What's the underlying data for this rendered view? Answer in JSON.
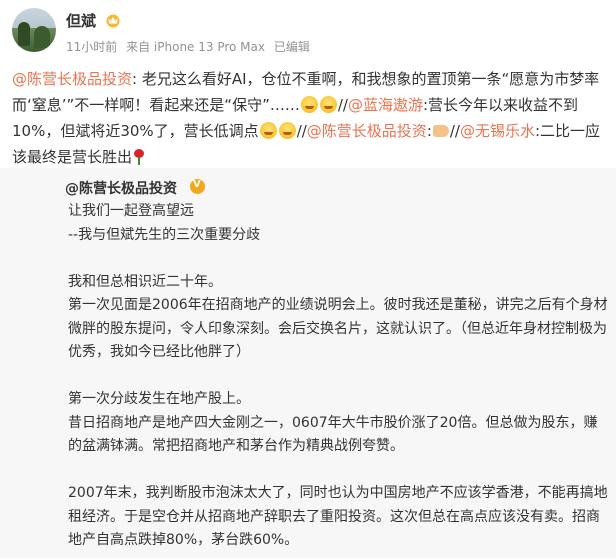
{
  "user": {
    "name": "但斌",
    "time": "11小时前",
    "source": "来自 iPhone 13 Pro Max",
    "edited": "已编辑"
  },
  "post": {
    "m1": "@陈营长极品投资",
    "t1": ": 老兄这么看好AI，仓位不重啊，和我想象的置顶第一条“愿意为市梦率而‘窒息’”不一样啊！看起来还是“保守”……",
    "t2": "//",
    "m2": "@蓝海遨游",
    "t3": ":营长今年以来收益不到10%，但斌将近30%了，营长低调点",
    "t4": "//",
    "m3": "@陈营长极品投资",
    "t5": ":",
    "t6": "//",
    "m4": "@无锡乐水",
    "t7": ":二比一应该最终是营长胜出"
  },
  "repost": {
    "author": "@陈营长极品投资",
    "lines": [
      "让我们一起登高望远",
      "--我与但斌先生的三次重要分歧",
      "",
      "我和但总相识近二十年。",
      "第一次见面是2006年在招商地产的业绩说明会上。彼时我还是董秘，讲完之后有个身材微胖的股东提问，令人印象深刻。会后交换名片，这就认识了。（但总近年身材控制极为优秀，我如今已经比他胖了）",
      "",
      "第一次分歧发生在地产股上。",
      "昔日招商地产是地产四大金刚之一，0607年大牛市股价涨了20倍。但总做为股东，赚的盆满钵满。常把招商地产和茅台作为精典战例夸赞。",
      "",
      "2007年末，我判断股市泡沫太大了，同时也认为中国房地产不应该学香港，不能再搞地租经济。于是空仓并从招商地产辞职去了重阳投资。这次但总在高点应该没有卖。招商地产自高点跌掉80%，茅台跌60%。"
    ]
  },
  "colors": {
    "mention": "#eb7350",
    "meta": "#939393",
    "repost_bg": "#f7f7f7"
  }
}
